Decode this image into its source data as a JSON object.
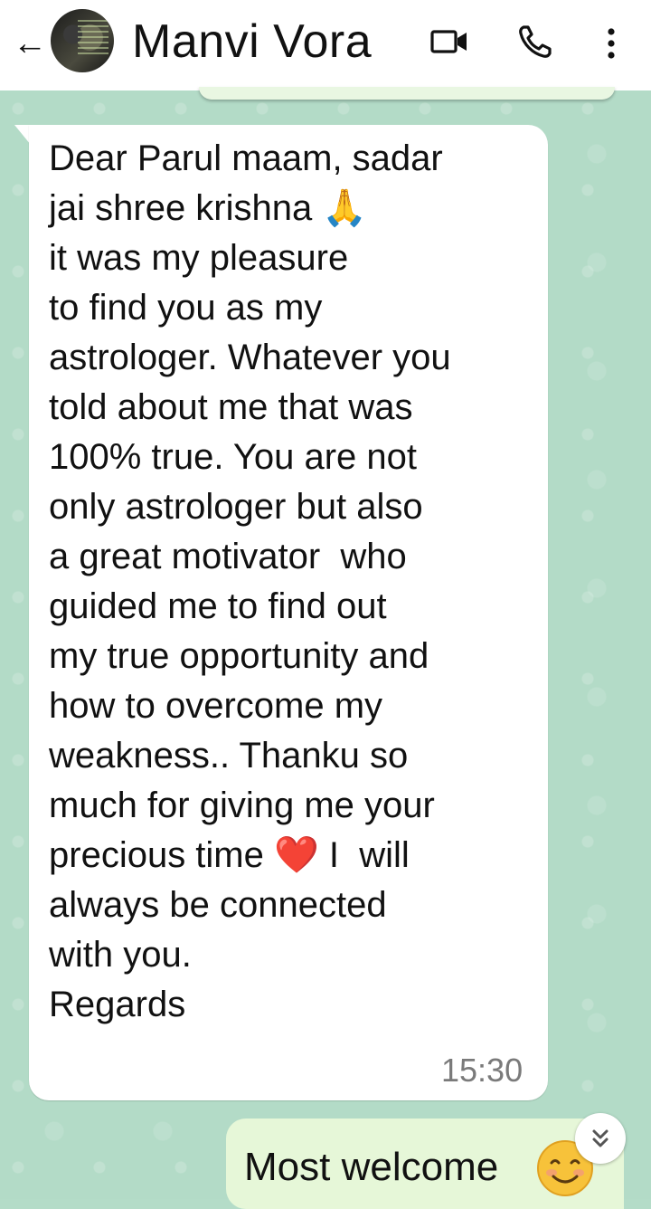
{
  "header": {
    "back_glyph": "←",
    "contact_name": "Manvi Vora",
    "icons": [
      "back-arrow-icon",
      "video-call-icon",
      "voice-call-icon",
      "more-options-icon"
    ]
  },
  "messages": [
    {
      "direction": "incoming",
      "lines": [
        "Dear Parul maam, sadar",
        "jai shree krishna 🙏",
        "it was my pleasure",
        "to find you as my",
        "astrologer. Whatever you",
        "told about me that was",
        "100% true. You are not",
        "only astrologer but also",
        "a great motivator  who",
        "guided me to find out",
        "my true opportunity and",
        "how to overcome my",
        "weakness.. Thanku so",
        "much for giving me your",
        "precious time ❤️ I  will",
        "always be connected",
        "with you.",
        "Regards"
      ],
      "time": "15:30"
    },
    {
      "direction": "outgoing",
      "text": "Most welcome",
      "emoji": "smiling-face-icon"
    }
  ],
  "colors": {
    "wallpaper": "#b3dbc7",
    "incoming_bubble": "#ffffff",
    "outgoing_bubble": "#e6f7d8",
    "timestamp": "#7a7a7a"
  }
}
